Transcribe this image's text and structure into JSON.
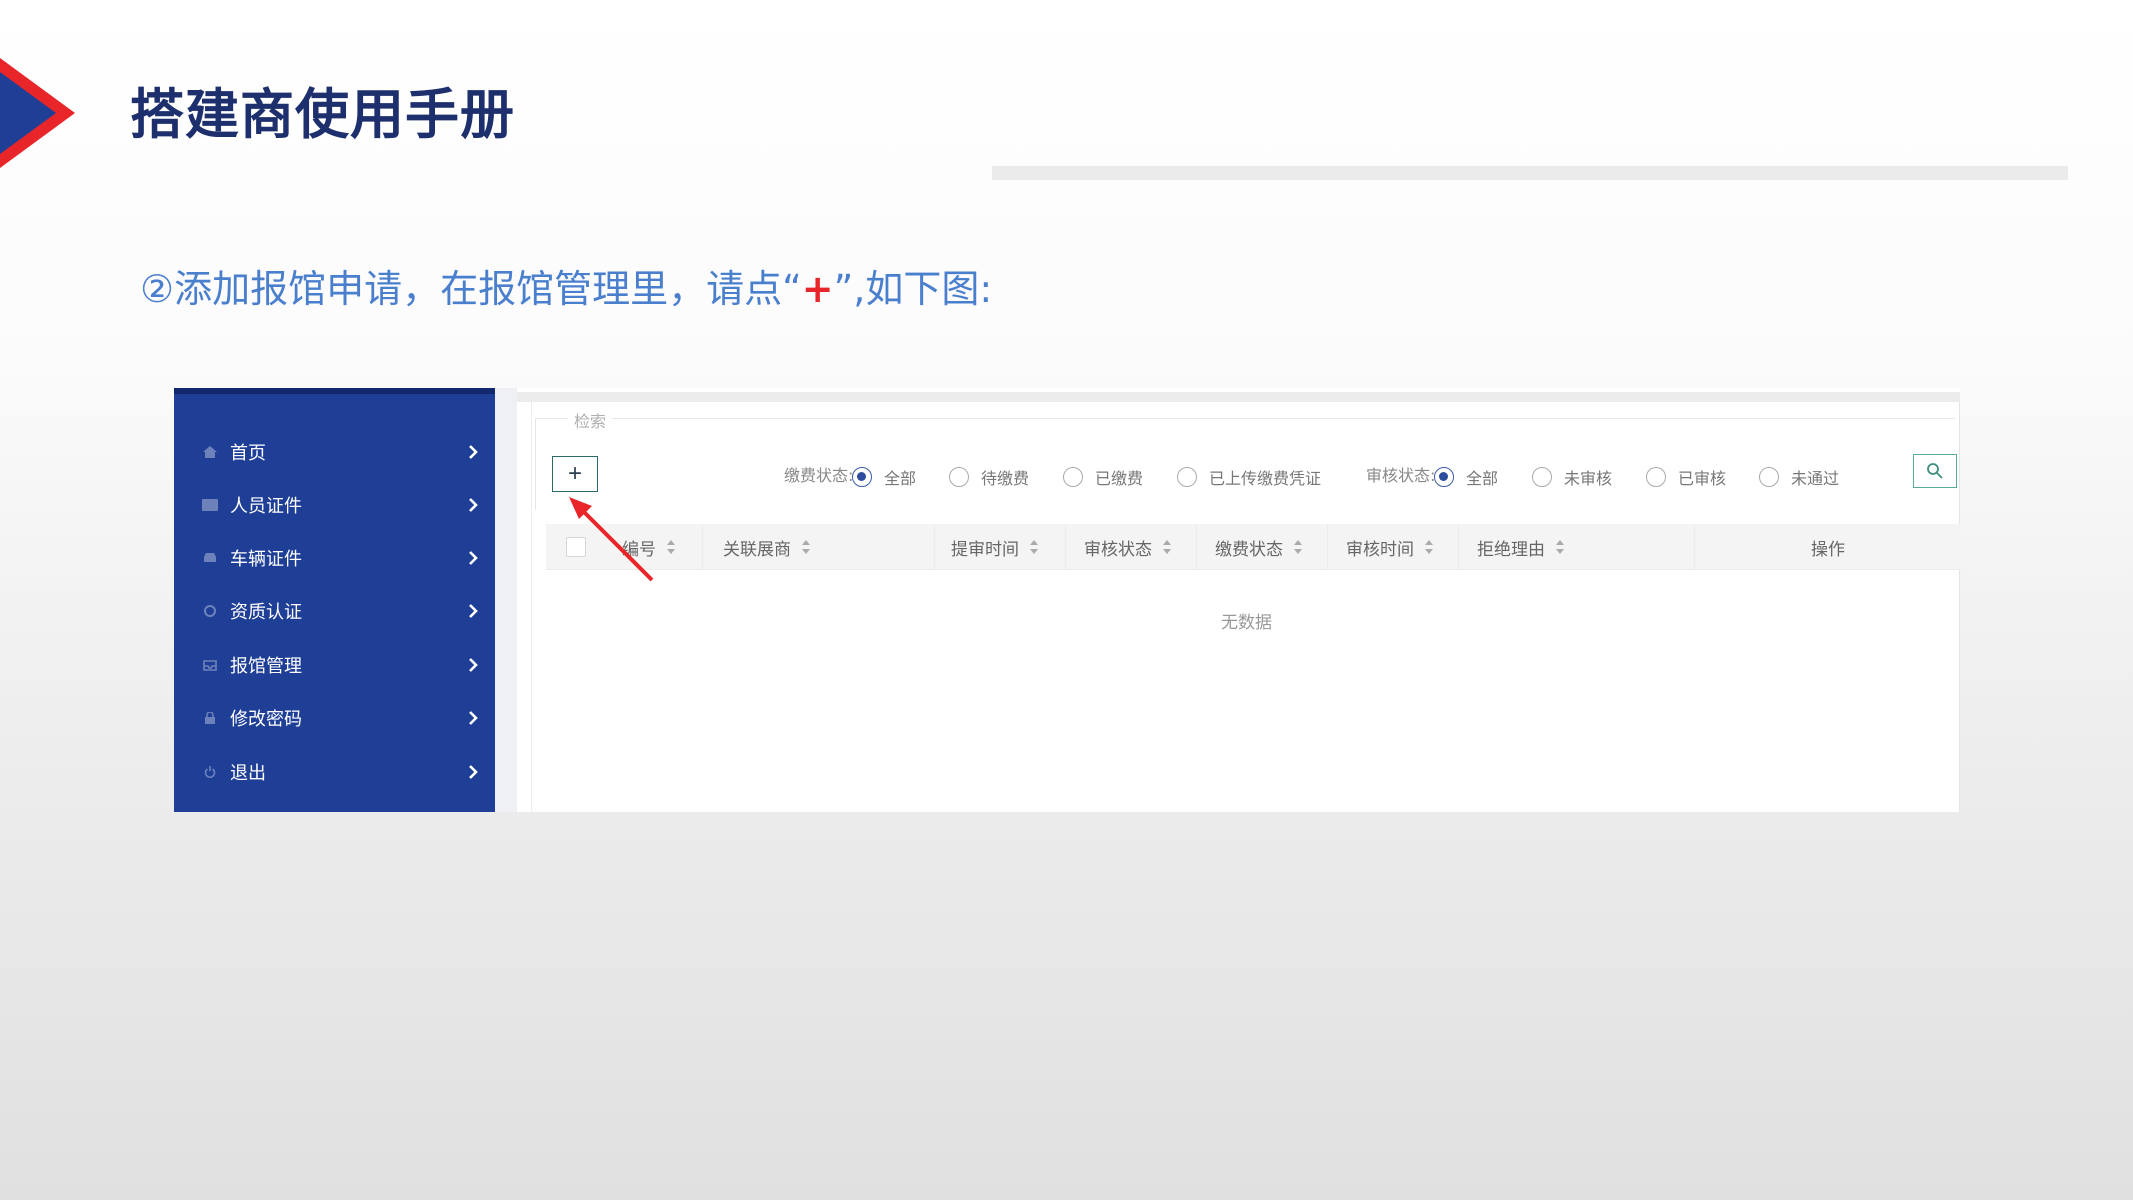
{
  "slide": {
    "title": "搭建商使用手册",
    "instruction_before": "②添加报馆申请，在报馆管理里，请点“",
    "instruction_plus": "+",
    "instruction_after": "”,如下图:"
  },
  "sidebar": {
    "items": [
      {
        "label": "首页",
        "icon": "home-icon"
      },
      {
        "label": "人员证件",
        "icon": "id-card-icon"
      },
      {
        "label": "车辆证件",
        "icon": "car-icon"
      },
      {
        "label": "资质认证",
        "icon": "gear-icon"
      },
      {
        "label": "报馆管理",
        "icon": "inbox-icon"
      },
      {
        "label": "修改密码",
        "icon": "lock-icon"
      },
      {
        "label": "退出",
        "icon": "power-icon"
      }
    ]
  },
  "search": {
    "legend": "检索",
    "add_label": "+",
    "payment_label": "缴费状态:",
    "payment_options": [
      "全部",
      "待缴费",
      "已缴费",
      "已上传缴费凭证"
    ],
    "payment_selected": 0,
    "review_label": "审核状态:",
    "review_options": [
      "全部",
      "未审核",
      "已审核",
      "未通过"
    ],
    "review_selected": 0
  },
  "table": {
    "columns": [
      "编号",
      "关联展商",
      "提审时间",
      "审核状态",
      "缴费状态",
      "审核时间",
      "拒绝理由",
      "操作"
    ],
    "empty_text": "无数据"
  },
  "colors": {
    "title": "#1e2f6e",
    "instruction": "#4a7fce",
    "accent_red": "#e8262a",
    "sidebar_bg": "#1f3f97"
  }
}
